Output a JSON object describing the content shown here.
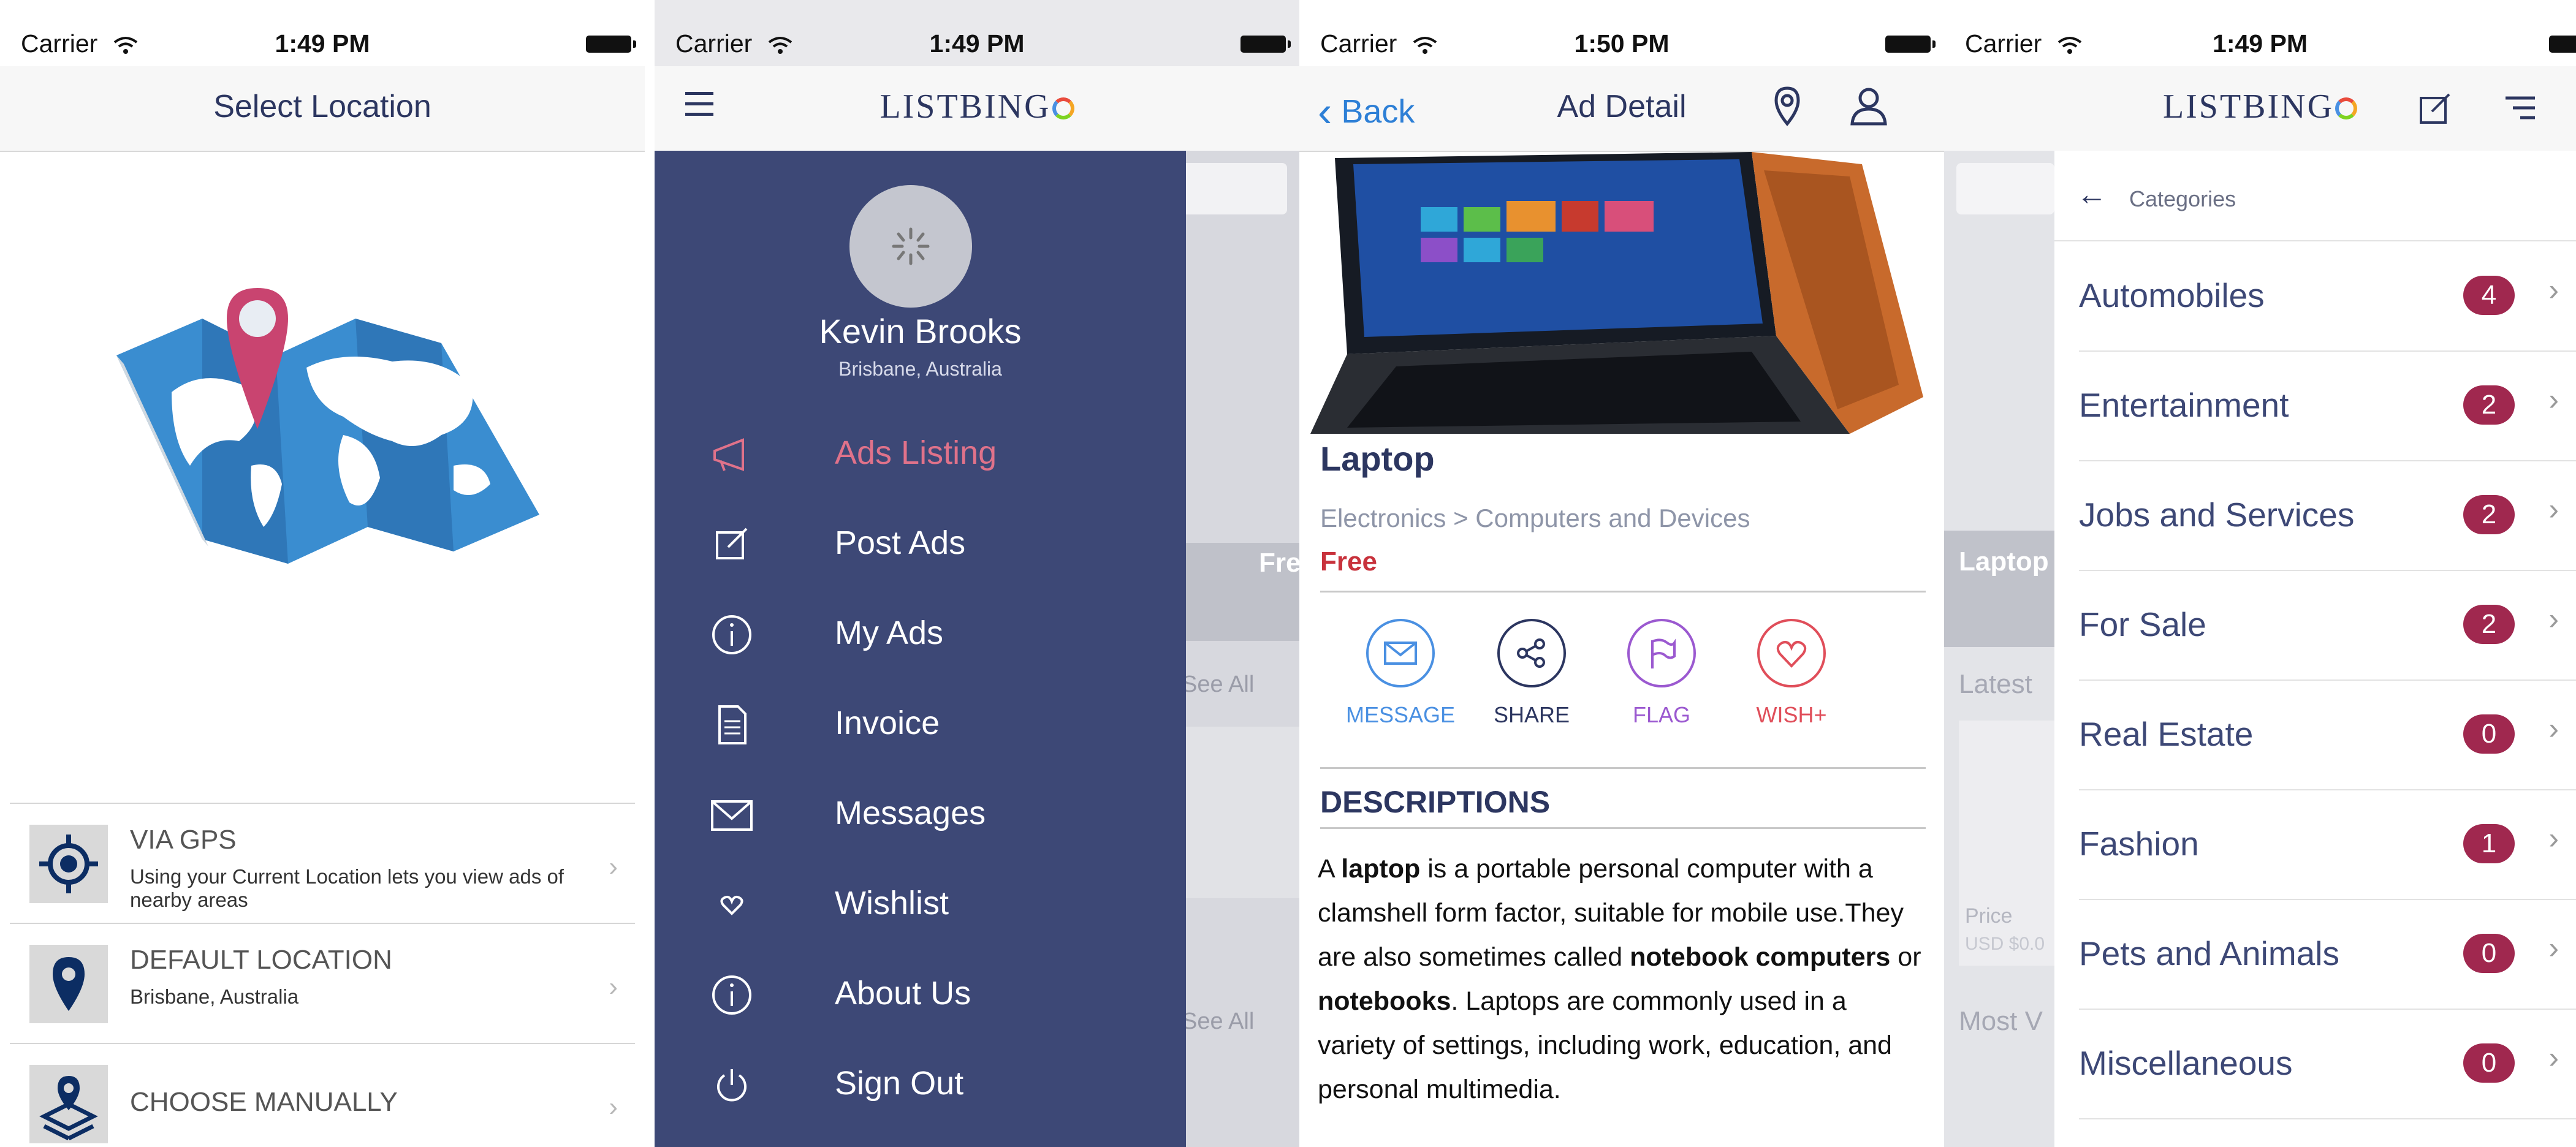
{
  "status": {
    "carrier": "Carrier",
    "times": [
      "1:49 PM",
      "1:49 PM",
      "1:50 PM",
      "1:49 PM"
    ]
  },
  "select_location": {
    "title": "Select Location",
    "options": [
      {
        "title": "VIA GPS",
        "subtitle": "Using your Current Location lets you view ads of nearby areas",
        "icon": "crosshair-icon"
      },
      {
        "title": "DEFAULT LOCATION",
        "subtitle": "Brisbane, Australia",
        "icon": "map-pin-icon"
      },
      {
        "title": "CHOOSE MANUALLY",
        "subtitle": "",
        "icon": "manual-location-icon"
      }
    ]
  },
  "menu": {
    "logo": "LISTBINGO",
    "profile": {
      "name": "Kevin Brooks",
      "location": "Brisbane, Australia"
    },
    "items": [
      {
        "label": "Ads Listing",
        "icon": "megaphone-icon",
        "active": true
      },
      {
        "label": "Post Ads",
        "icon": "edit-icon",
        "active": false
      },
      {
        "label": "My Ads",
        "icon": "info-icon",
        "active": false
      },
      {
        "label": "Invoice",
        "icon": "document-icon",
        "active": false
      },
      {
        "label": "Messages",
        "icon": "envelope-icon",
        "active": false
      },
      {
        "label": "Wishlist",
        "icon": "heart-icon",
        "active": false
      },
      {
        "label": "About Us",
        "icon": "info-icon",
        "active": false
      },
      {
        "label": "Sign Out",
        "icon": "power-icon",
        "active": false
      }
    ],
    "background_texts": {
      "free": "Free",
      "see_all_1": "See All",
      "see_all_2": "See All"
    }
  },
  "ad_detail": {
    "back": "Back",
    "title": "Ad Detail",
    "item_title": "Laptop",
    "category": "Electronics > Computers and Devices",
    "price": "Free",
    "actions": [
      {
        "label": "MESSAGE",
        "color": "#4a90e2",
        "icon": "envelope-icon"
      },
      {
        "label": "SHARE",
        "color": "#2c3660",
        "icon": "share-icon"
      },
      {
        "label": "FLAG",
        "color": "#9b59d0",
        "icon": "flag-icon"
      },
      {
        "label": "WISH+",
        "color": "#e04e5a",
        "icon": "heart-icon"
      }
    ],
    "descriptions_heading": "DESCRIPTIONS",
    "description": {
      "p1": "A ",
      "b1": "laptop",
      "p2": " is a portable personal computer with a clamshell form factor, suitable for mobile use.They are also sometimes called ",
      "b2": "notebook computers",
      "p3": " or ",
      "b3": "notebooks",
      "p4": ". Laptops are commonly used in a variety of settings, including work, education, and personal multimedia."
    }
  },
  "categories": {
    "logo": "LISTBINGO",
    "header": "Categories",
    "items": [
      {
        "label": "Automobiles",
        "count": "4"
      },
      {
        "label": "Entertainment",
        "count": "2"
      },
      {
        "label": "Jobs and Services",
        "count": "2"
      },
      {
        "label": "For Sale",
        "count": "2"
      },
      {
        "label": "Real Estate",
        "count": "0"
      },
      {
        "label": "Fashion",
        "count": "1"
      },
      {
        "label": "Pets and Animals",
        "count": "0"
      },
      {
        "label": "Miscellaneous",
        "count": "0"
      }
    ],
    "background_texts": {
      "laptop": "Laptop",
      "latest": "Latest",
      "price": "Price",
      "usd": "USD $0.0",
      "most": "Most V"
    }
  }
}
